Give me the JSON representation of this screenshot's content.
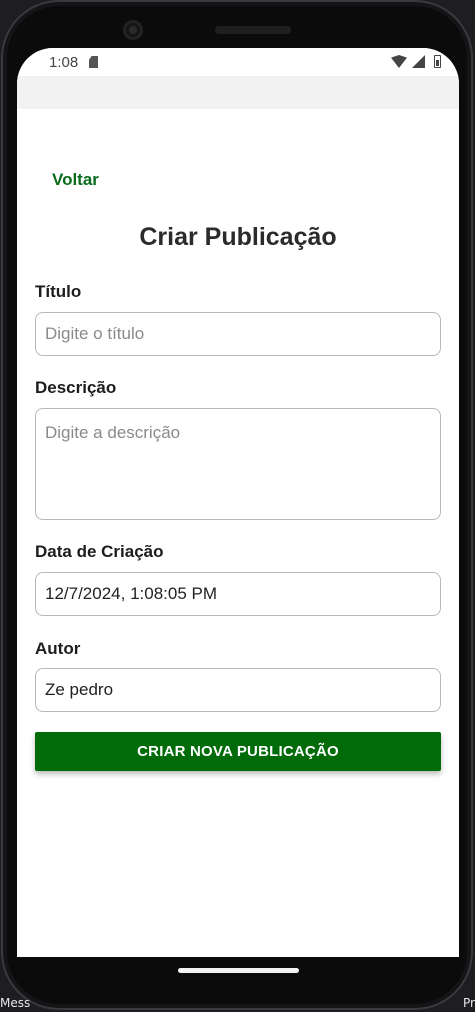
{
  "status_bar": {
    "time": "1:08"
  },
  "page": {
    "back_label": "Voltar",
    "title": "Criar Publicação"
  },
  "form": {
    "title_label": "Título",
    "title_placeholder": "Digite o título",
    "description_label": "Descrição",
    "description_placeholder": "Digite a descrição",
    "created_label": "Data de Criação",
    "created_value": "12/7/2024, 1:08:05 PM",
    "author_label": "Autor",
    "author_value": "Ze pedro",
    "submit_label": "CRIAR NOVA PUBLICAÇÃO"
  },
  "backdrop": {
    "left_text": "Mess",
    "right_text": "Pr"
  },
  "colors": {
    "accent": "#016b0a",
    "link": "#0b6b1c"
  },
  "icons": [
    "sd-card-icon",
    "wifi-icon",
    "signal-icon",
    "battery-icon"
  ]
}
